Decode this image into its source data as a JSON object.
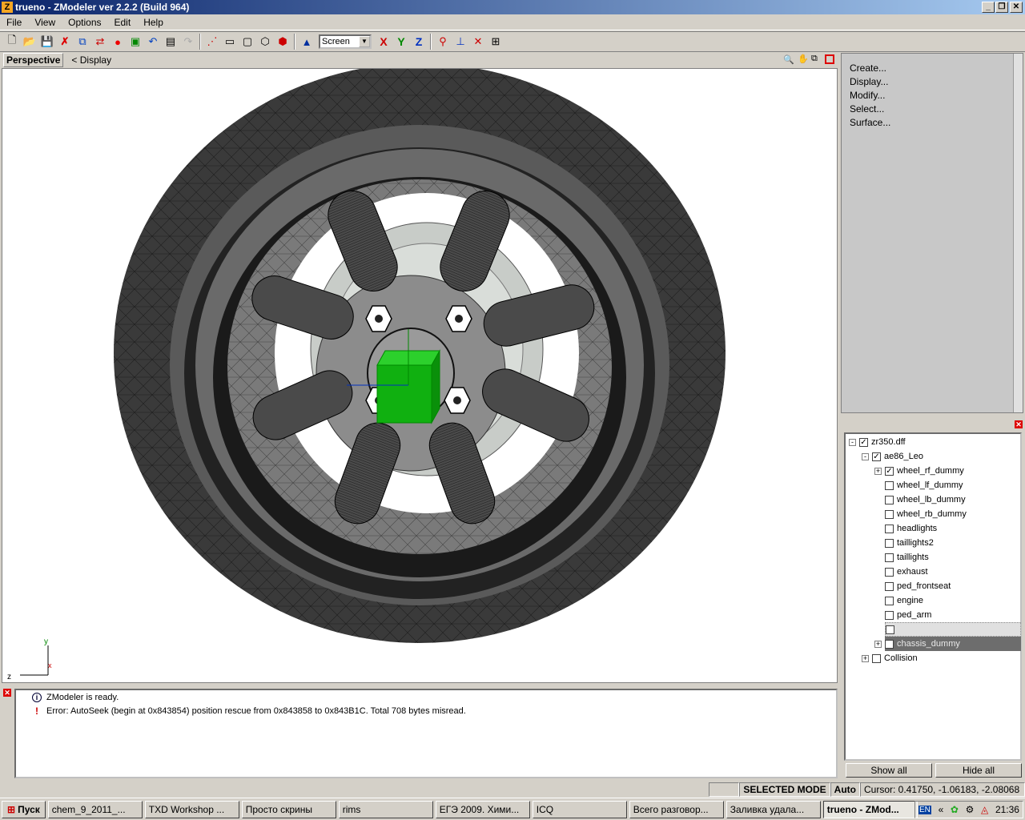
{
  "window": {
    "title": "trueno - ZModeler ver 2.2.2 (Build 964)",
    "icon_letter": "Z"
  },
  "menu": [
    "File",
    "View",
    "Options",
    "Edit",
    "Help"
  ],
  "toolbar": {
    "coord_select": "Screen",
    "axis_x": "X",
    "axis_y": "Y",
    "axis_z": "Z"
  },
  "viewport": {
    "label": "Perspective",
    "display_link": "< Display",
    "axis_y": "y",
    "axis_z": "z",
    "axis_x": "x"
  },
  "command_panel": {
    "items": [
      "Create...",
      "Display...",
      "Modify...",
      "Select...",
      "Surface..."
    ]
  },
  "tree": {
    "nodes": [
      {
        "label": "zr350.dff",
        "checked": true,
        "expander": "-"
      },
      {
        "label": "ae86_Leo",
        "checked": true,
        "expander": "-"
      },
      {
        "label": "wheel_rf_dummy",
        "checked": true,
        "expander": "+"
      },
      {
        "label": "wheel_lf_dummy",
        "checked": false,
        "expander": ""
      },
      {
        "label": "wheel_lb_dummy",
        "checked": false,
        "expander": ""
      },
      {
        "label": "wheel_rb_dummy",
        "checked": false,
        "expander": ""
      },
      {
        "label": "headlights",
        "checked": false,
        "expander": ""
      },
      {
        "label": "taillights2",
        "checked": false,
        "expander": ""
      },
      {
        "label": "taillights",
        "checked": false,
        "expander": ""
      },
      {
        "label": "exhaust",
        "checked": false,
        "expander": ""
      },
      {
        "label": "ped_frontseat",
        "checked": false,
        "expander": ""
      },
      {
        "label": "engine",
        "checked": false,
        "expander": ""
      },
      {
        "label": "ped_arm",
        "checked": false,
        "expander": ""
      },
      {
        "label": "",
        "checked": false,
        "expander": ""
      },
      {
        "label": "chassis_dummy",
        "checked": false,
        "expander": "+"
      },
      {
        "label": "Collision",
        "checked": false,
        "expander": "+"
      }
    ],
    "show_all": "Show all",
    "hide_all": "Hide all"
  },
  "log": {
    "lines": [
      {
        "icon": "info-icon",
        "text": "ZModeler is ready."
      },
      {
        "icon": "error-icon",
        "text": "Error: AutoSeek (begin at 0x843854) position rescue  from 0x843858 to 0x843B1C. Total 708 bytes misread."
      }
    ]
  },
  "status": {
    "mode": "SELECTED MODE",
    "snap": "Auto",
    "cursor": "Cursor: 0.41750, -1.06183, -2.08068"
  },
  "taskbar": {
    "start": "Пуск",
    "tasks": [
      {
        "label": "chem_9_2011_...",
        "active": false
      },
      {
        "label": "TXD Workshop ...",
        "active": false
      },
      {
        "label": "Просто скрины",
        "active": false
      },
      {
        "label": "rims",
        "active": false
      },
      {
        "label": "ЕГЭ 2009. Хими...",
        "active": false
      },
      {
        "label": "ICQ",
        "active": false
      },
      {
        "label": "Всего разговор...",
        "active": false
      },
      {
        "label": "Заливка удала...",
        "active": false
      },
      {
        "label": "trueno - ZMod...",
        "active": true
      }
    ],
    "lang": "EN",
    "clock": "21:36"
  },
  "colors": {
    "tire": "#3a3a3a",
    "rim": "#8a8a8a",
    "dummy_cube": "#10b010",
    "title_gradient_start": "#0a246a"
  }
}
